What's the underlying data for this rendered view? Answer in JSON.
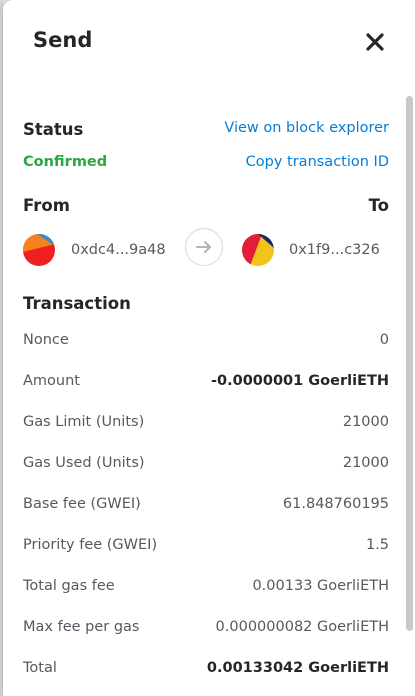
{
  "modal": {
    "title": "Send"
  },
  "status": {
    "label": "Status",
    "value": "Confirmed",
    "explorer_link": "View on block explorer",
    "copy_link": "Copy transaction ID"
  },
  "parties": {
    "from_label": "From",
    "to_label": "To",
    "from_address": "0xdc4...9a48",
    "to_address": "0x1f9...c326"
  },
  "transaction": {
    "heading": "Transaction",
    "rows": [
      {
        "label": "Nonce",
        "value": "0"
      },
      {
        "label": "Amount",
        "value": "-0.0000001 GoerliETH"
      },
      {
        "label": "Gas Limit (Units)",
        "value": "21000"
      },
      {
        "label": "Gas Used (Units)",
        "value": "21000"
      },
      {
        "label": "Base fee (GWEI)",
        "value": "61.848760195"
      },
      {
        "label": "Priority fee (GWEI)",
        "value": "1.5"
      },
      {
        "label": "Total gas fee",
        "value": "0.00133 GoerliETH"
      },
      {
        "label": "Max fee per gas",
        "value": "0.000000082 GoerliETH"
      },
      {
        "label": "Total",
        "value": "0.00133042 GoerliETH"
      }
    ]
  },
  "icons": {
    "close": "close-icon",
    "arrow": "arrow-right-icon"
  },
  "colors": {
    "link": "#037dd6",
    "confirmed": "#28a745"
  }
}
